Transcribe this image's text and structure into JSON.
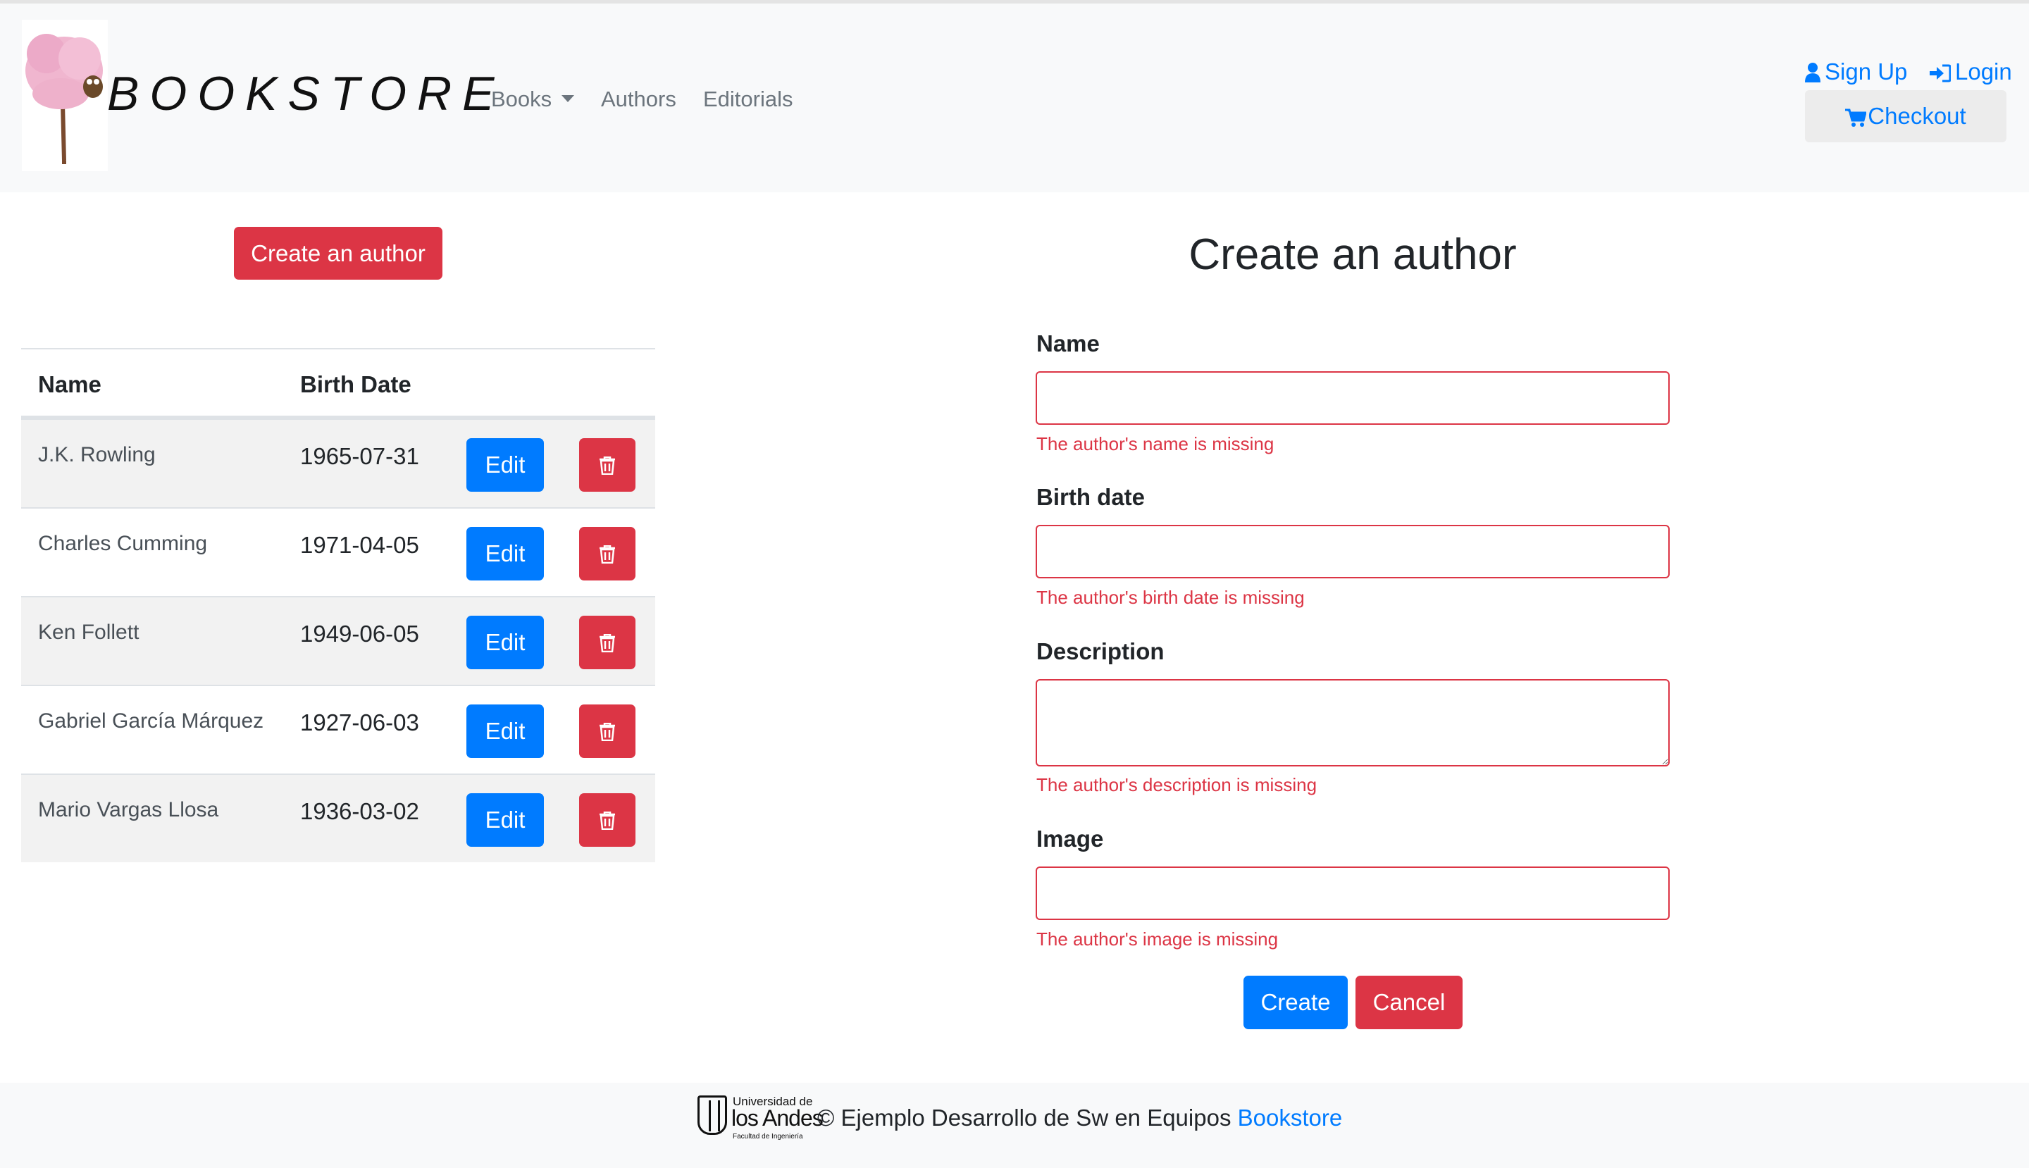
{
  "navbar": {
    "brand": "BOOKSTORE",
    "links": [
      {
        "label": "Books",
        "dropdown": true
      },
      {
        "label": "Authors"
      },
      {
        "label": "Editorials"
      }
    ],
    "sign_up": "Sign Up",
    "login": "Login",
    "checkout": "Checkout"
  },
  "authors_panel": {
    "create_button": "Create an author",
    "columns": [
      "Name",
      "Birth Date"
    ],
    "rows": [
      {
        "name": "J.K. Rowling",
        "birth_date": "1965-07-31"
      },
      {
        "name": "Charles Cumming",
        "birth_date": "1971-04-05"
      },
      {
        "name": "Ken Follett",
        "birth_date": "1949-06-05"
      },
      {
        "name": "Gabriel García Márquez",
        "birth_date": "1927-06-03"
      },
      {
        "name": "Mario Vargas Llosa",
        "birth_date": "1936-03-02"
      }
    ],
    "edit_label": "Edit",
    "delete_icon": "trash-icon"
  },
  "form": {
    "title": "Create an author",
    "fields": [
      {
        "label": "Name",
        "value": "",
        "error": "The author's name is missing"
      },
      {
        "label": "Birth date",
        "value": "",
        "error": "The author's birth date is missing"
      },
      {
        "label": "Description",
        "value": "",
        "error": "The author's description is missing"
      },
      {
        "label": "Image",
        "value": "",
        "error": "The author's image is missing"
      }
    ],
    "create_label": "Create",
    "cancel_label": "Cancel"
  },
  "footer": {
    "logo_line1": "Universidad de",
    "logo_line2": "los Andes",
    "logo_line3": "Facultad de Ingeniería",
    "text": "© Ejemplo Desarrollo de Sw en Equipos",
    "link": "Bookstore"
  },
  "colors": {
    "primary": "#007bff",
    "danger": "#dc3545",
    "navbar_bg": "#f8f9fa",
    "stripe": "#f2f2f2"
  }
}
